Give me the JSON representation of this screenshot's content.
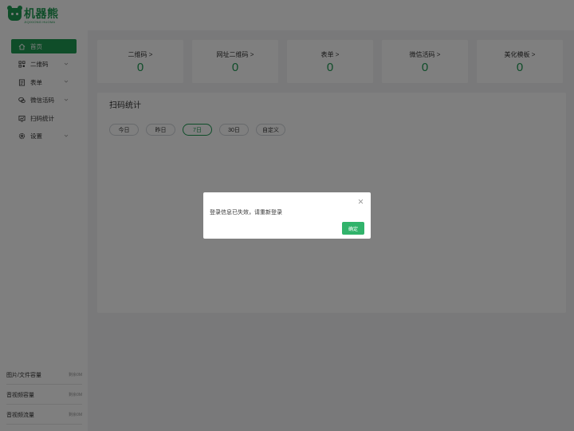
{
  "app": {
    "brand_name": "机器熊",
    "brand_sub": "JIQIXIONG HUOMA",
    "brand_color": "#1e9a52"
  },
  "sidebar": {
    "items": [
      {
        "label": "首页",
        "icon": "home-icon",
        "active": true,
        "has_chevron": false
      },
      {
        "label": "二维码",
        "icon": "qrcode-icon",
        "active": false,
        "has_chevron": true
      },
      {
        "label": "表单",
        "icon": "form-icon",
        "active": false,
        "has_chevron": true
      },
      {
        "label": "微信活码",
        "icon": "wechat-icon",
        "active": false,
        "has_chevron": true
      },
      {
        "label": "扫码统计",
        "icon": "chart-icon",
        "active": false,
        "has_chevron": false
      },
      {
        "label": "设置",
        "icon": "gear-icon",
        "active": false,
        "has_chevron": true
      }
    ],
    "quotas": [
      {
        "label": "图片/文件容量",
        "value": "剩余0M"
      },
      {
        "label": "音视频容量",
        "value": "剩余0M"
      },
      {
        "label": "音视频流量",
        "value": "剩余0M"
      }
    ]
  },
  "stats": [
    {
      "label": "二维码 >",
      "value": "0"
    },
    {
      "label": "网址二维码 >",
      "value": "0"
    },
    {
      "label": "表单 >",
      "value": "0"
    },
    {
      "label": "微信活码 >",
      "value": "0"
    },
    {
      "label": "美化模板 >",
      "value": "0"
    }
  ],
  "scan_panel": {
    "title": "扫码统计",
    "ranges": [
      {
        "label": "今日",
        "active": false
      },
      {
        "label": "昨日",
        "active": false
      },
      {
        "label": "7日",
        "active": true
      },
      {
        "label": "30日",
        "active": false
      },
      {
        "label": "自定义",
        "active": false
      }
    ]
  },
  "modal": {
    "message": "登录信息已失效，请重新登录",
    "ok_label": "确定",
    "ok_color": "#31b36b"
  }
}
